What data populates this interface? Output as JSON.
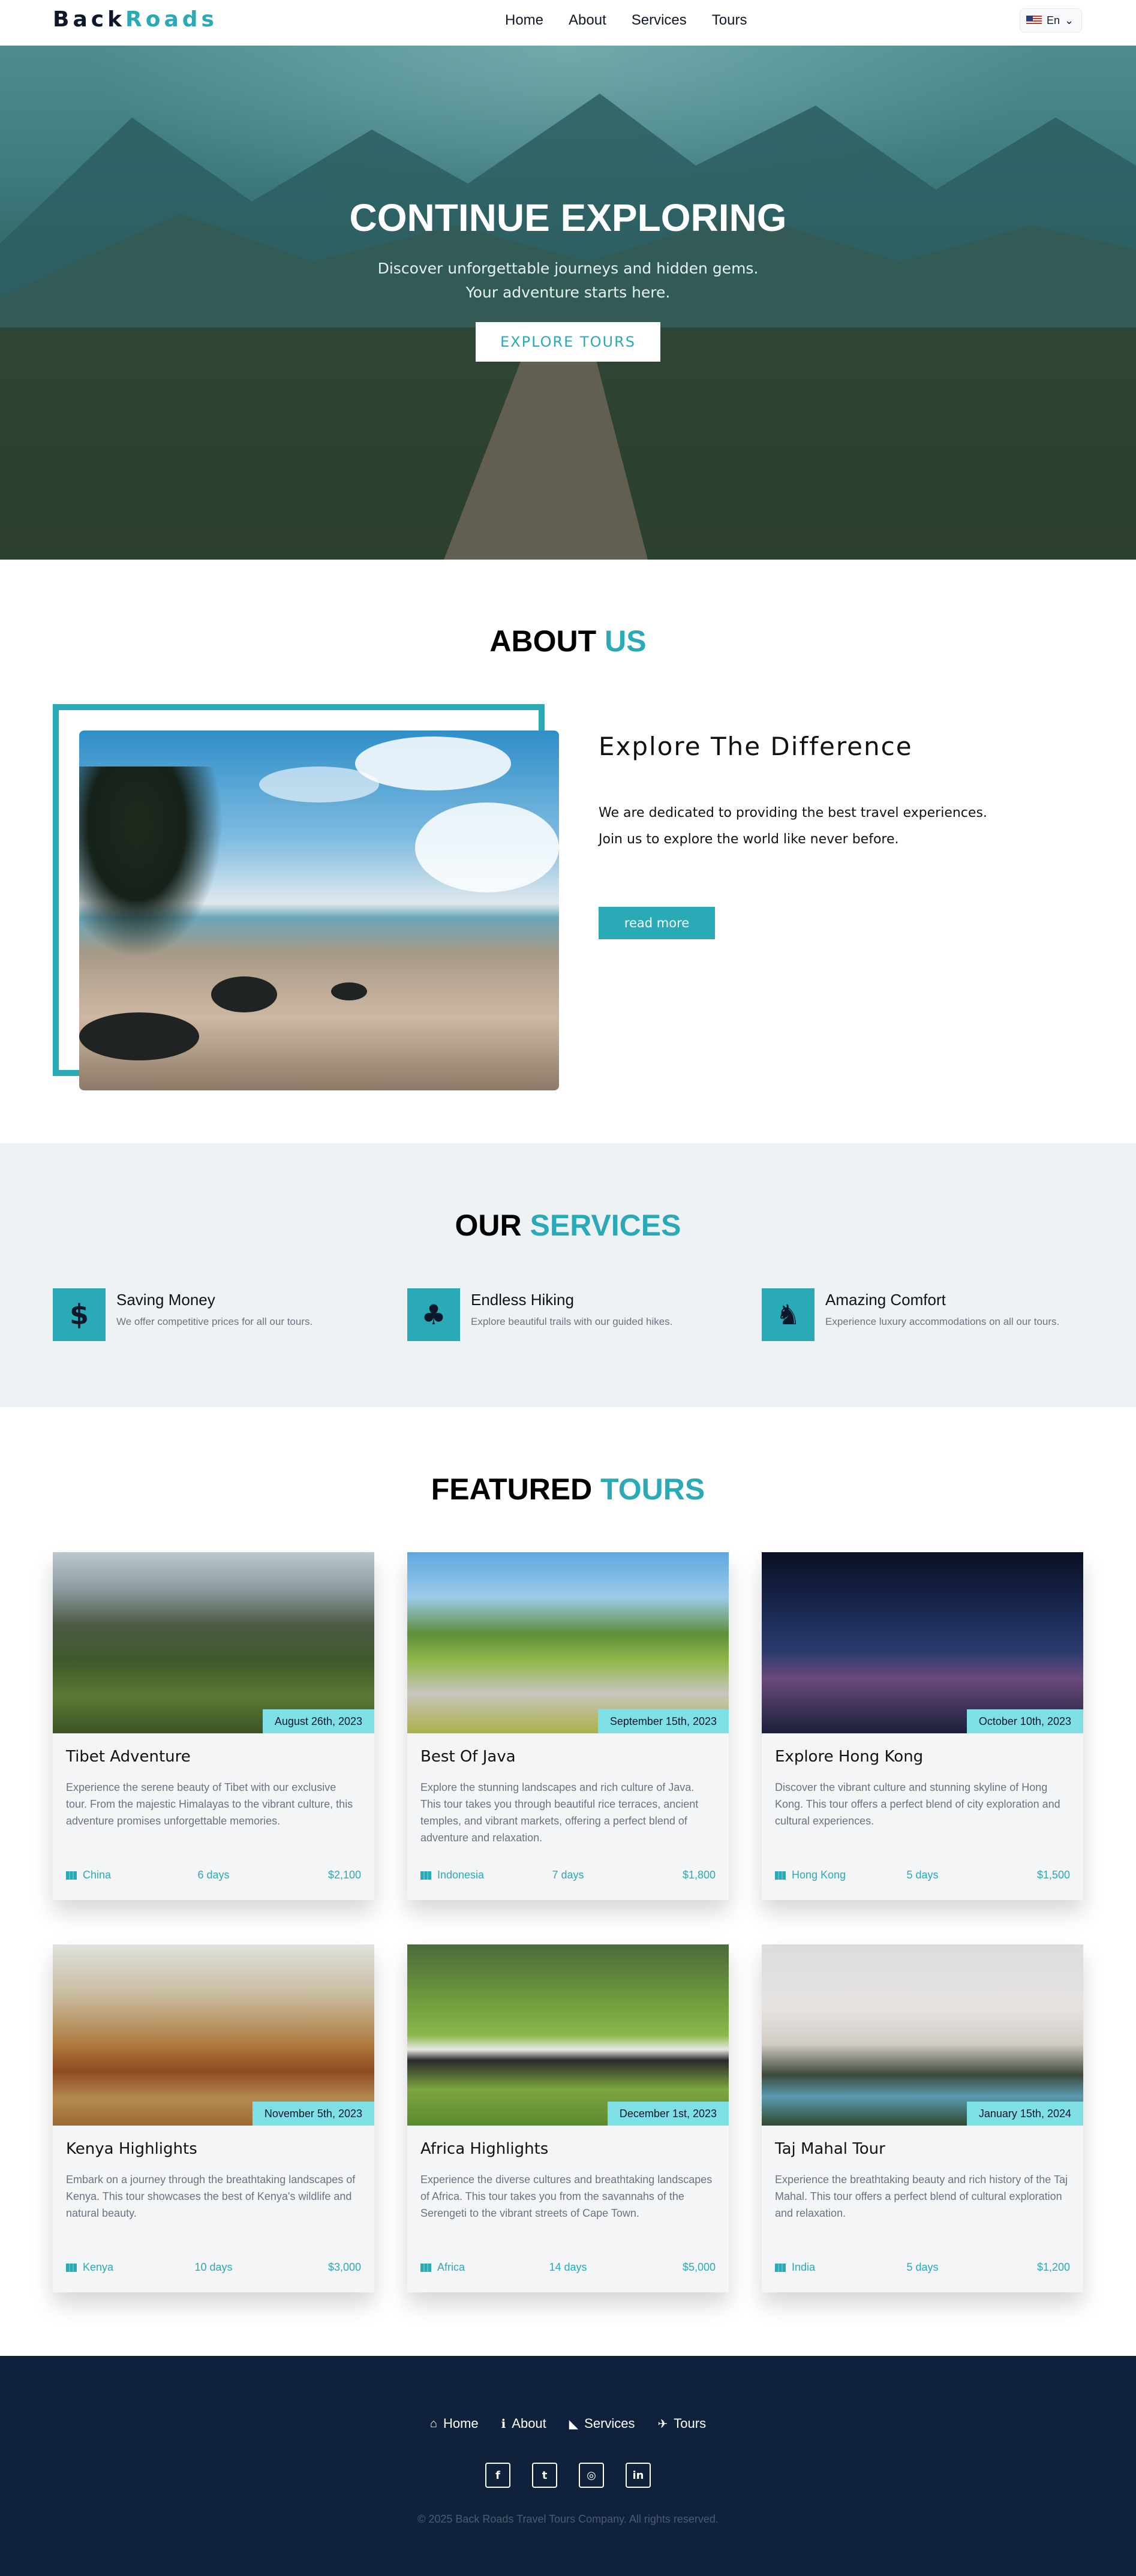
{
  "nav": {
    "brand_part1": "Back",
    "brand_part2": "Roads",
    "links": [
      "Home",
      "About",
      "Services",
      "Tours"
    ],
    "language": "En"
  },
  "hero": {
    "title": "CONTINUE EXPLORING",
    "subtitle_line1": "Discover unforgettable journeys and hidden gems.",
    "subtitle_line2": "Your adventure starts here.",
    "button": "EXPLORE TOURS"
  },
  "about": {
    "title_part1": "ABOUT",
    "title_part2": "US",
    "heading": "Explore The Difference",
    "text_line1": "We are dedicated to providing the best travel experiences.",
    "text_line2": "Join us to explore the world like never before.",
    "button": "read more"
  },
  "services": {
    "title_part1": "OUR",
    "title_part2": "SERVICES",
    "items": [
      {
        "icon": "dollar-icon",
        "glyph": "$",
        "title": "Saving Money",
        "text": "We offer competitive prices for all our tours."
      },
      {
        "icon": "tree-icon",
        "glyph": "♣",
        "title": "Endless Hiking",
        "text": "Explore beautiful trails with our guided hikes."
      },
      {
        "icon": "socks-icon",
        "glyph": "♞",
        "title": "Amazing Comfort",
        "text": "Experience luxury accommodations on all our tours."
      }
    ]
  },
  "tours": {
    "title_part1": "FEATURED",
    "title_part2": "TOURS",
    "items": [
      {
        "title": "Tibet Adventure",
        "date": "August 26th, 2023",
        "desc": "Experience the serene beauty of Tibet with our exclusive tour. From the majestic Himalayas to the vibrant culture, this adventure promises unforgettable memories.",
        "location": "China",
        "days": "6 days",
        "price": "$2,100"
      },
      {
        "title": "Best Of Java",
        "date": "September 15th, 2023",
        "desc": "Explore the stunning landscapes and rich culture of Java. This tour takes you through beautiful rice terraces, ancient temples, and vibrant markets, offering a perfect blend of adventure and relaxation.",
        "location": "Indonesia",
        "days": "7 days",
        "price": "$1,800"
      },
      {
        "title": "Explore Hong Kong",
        "date": "October 10th, 2023",
        "desc": "Discover the vibrant culture and stunning skyline of Hong Kong. This tour offers a perfect blend of city exploration and cultural experiences.",
        "location": "Hong Kong",
        "days": "5 days",
        "price": "$1,500"
      },
      {
        "title": "Kenya Highlights",
        "date": "November 5th, 2023",
        "desc": "Embark on a journey through the breathtaking landscapes of Kenya. This tour showcases the best of Kenya's wildlife and natural beauty.",
        "location": "Kenya",
        "days": "10 days",
        "price": "$3,000"
      },
      {
        "title": "Africa Highlights",
        "date": "December 1st, 2023",
        "desc": "Experience the diverse cultures and breathtaking landscapes of Africa. This tour takes you from the savannahs of the Serengeti to the vibrant streets of Cape Town.",
        "location": "Africa",
        "days": "14 days",
        "price": "$5,000"
      },
      {
        "title": "Taj Mahal Tour",
        "date": "January 15th, 2024",
        "desc": "Experience the breathtaking beauty and rich history of the Taj Mahal. This tour offers a perfect blend of cultural exploration and relaxation.",
        "location": "India",
        "days": "5 days",
        "price": "$1,200"
      }
    ]
  },
  "footer": {
    "links": [
      {
        "icon": "home-icon",
        "glyph": "⌂",
        "label": "Home"
      },
      {
        "icon": "info-icon",
        "glyph": "ℹ",
        "label": "About"
      },
      {
        "icon": "hiking-icon",
        "glyph": "◣",
        "label": "Services"
      },
      {
        "icon": "plane-icon",
        "glyph": "✈",
        "label": "Tours"
      }
    ],
    "social": [
      {
        "icon": "facebook-icon",
        "glyph": "f"
      },
      {
        "icon": "twitter-icon",
        "glyph": "t"
      },
      {
        "icon": "instagram-icon",
        "glyph": "◎"
      },
      {
        "icon": "linkedin-icon",
        "glyph": "in"
      }
    ],
    "copyright": "© 2025 Back Roads Travel Tours Company. All rights reserved."
  },
  "colors": {
    "accent": "#2aa9b6",
    "date_badge": "#7ee0e6",
    "footer_bg": "#10223b",
    "services_bg": "#eef2f5"
  }
}
